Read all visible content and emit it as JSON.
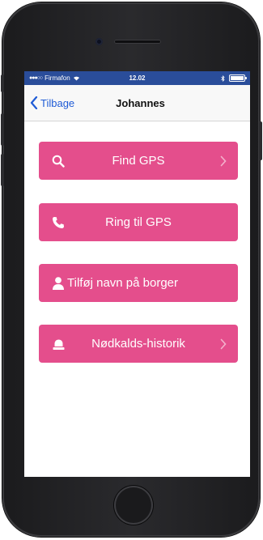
{
  "status_bar": {
    "carrier": "Firmafon",
    "time": "12.02"
  },
  "nav": {
    "back_label": "Tilbage",
    "title": "Johannes"
  },
  "menu": [
    {
      "label": "Find GPS",
      "icon": "search-icon",
      "chevron": true
    },
    {
      "label": "Ring til GPS",
      "icon": "phone-icon",
      "chevron": false
    },
    {
      "label": "Tilføj navn på borger",
      "icon": "person-icon",
      "chevron": false
    },
    {
      "label": "Nødkalds-historik",
      "icon": "alarm-light-icon",
      "chevron": true
    }
  ],
  "colors": {
    "accent": "#e44e8c",
    "status_bar": "#2a4d9a",
    "link": "#1f5bd6"
  }
}
